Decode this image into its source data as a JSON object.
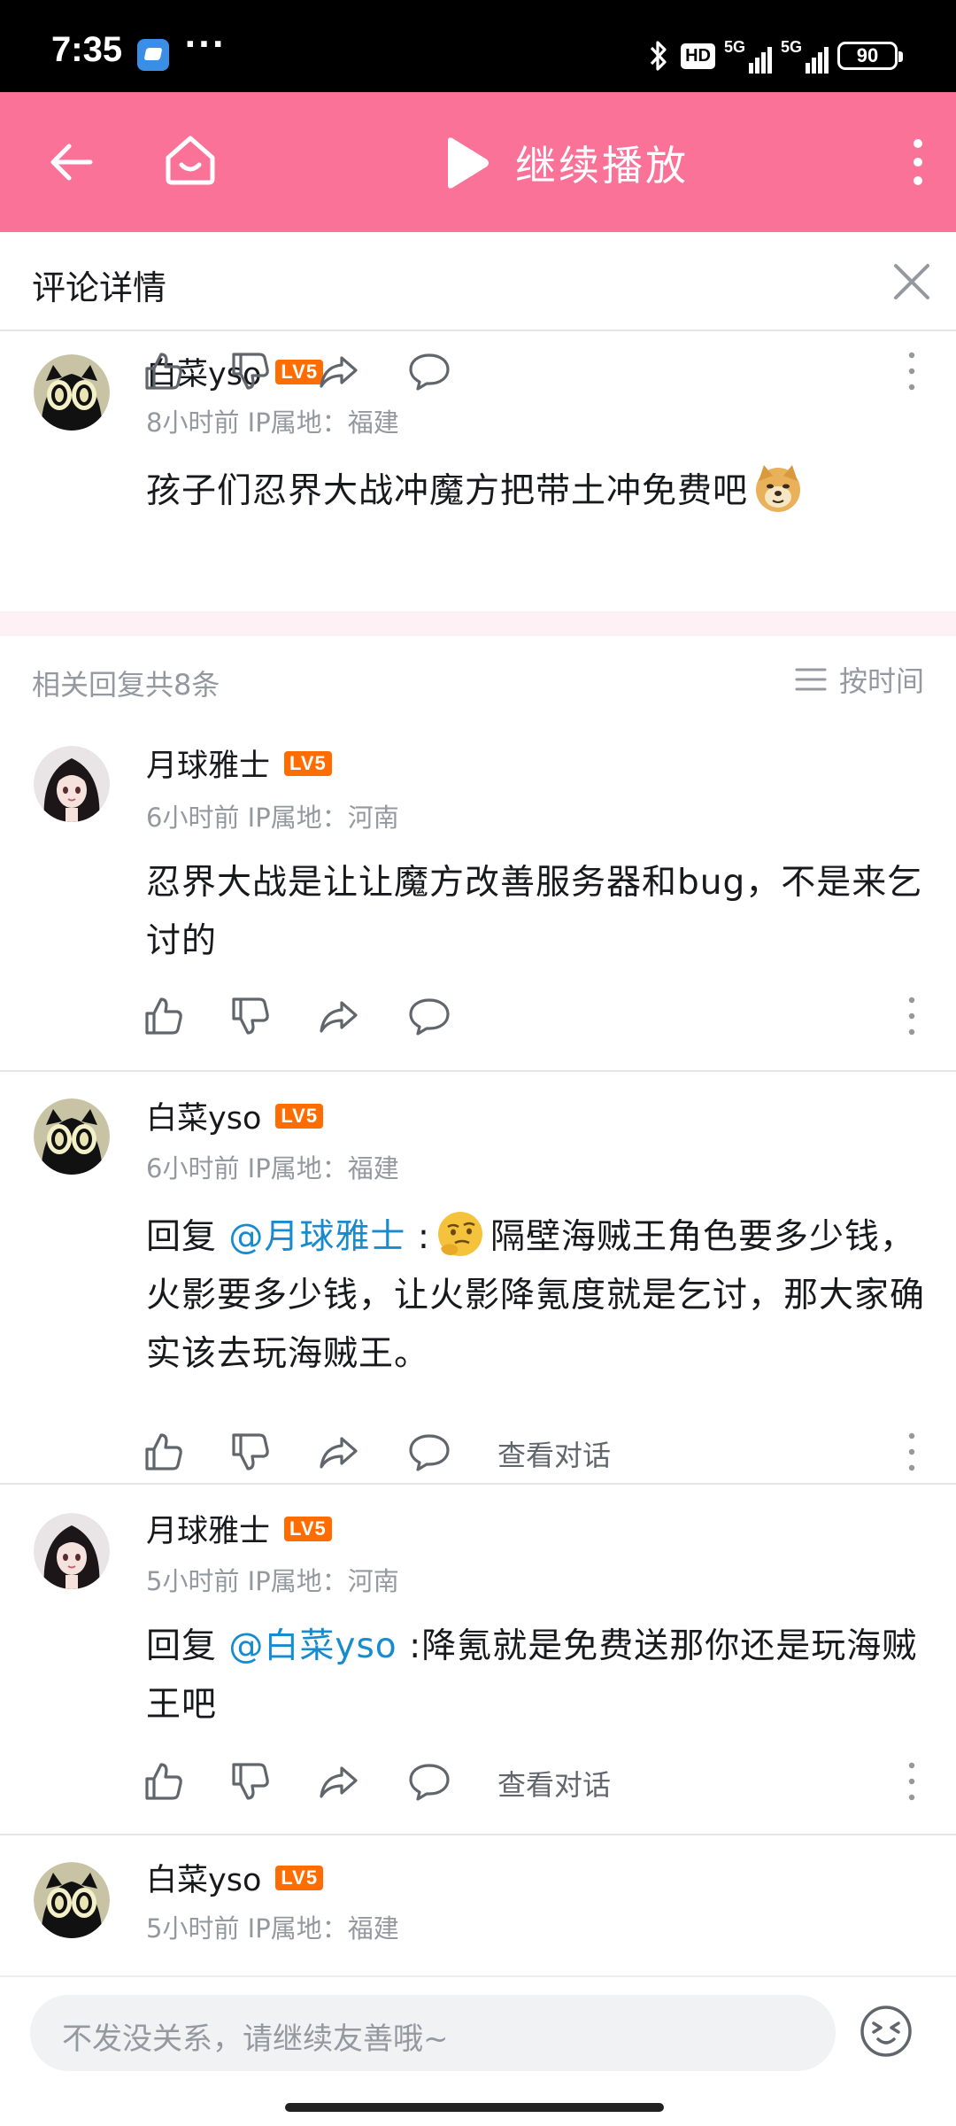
{
  "status_bar": {
    "time": "7:35",
    "dots": "···",
    "hd": "HD",
    "net1": "5G",
    "net2": "5G",
    "battery": "90"
  },
  "top_bar": {
    "back_icon": "back-arrow-icon",
    "home_icon": "home-icon",
    "play_label": "继续播放",
    "more_icon": "more-vertical-icon",
    "background": "#fb7299"
  },
  "detail": {
    "title": "评论详情",
    "close_icon": "close-icon"
  },
  "main_comment": {
    "user": "白菜yso",
    "level": "LV5",
    "meta": "8小时前 IP属地：福建",
    "text": "孩子们忍界大战冲魔方把带土冲免费吧",
    "emoji": "doge-emoji"
  },
  "replies_header": {
    "count": "相关回复共8条",
    "sort": "按时间"
  },
  "replies": [
    {
      "user": "月球雅士",
      "level": "LV5",
      "meta": "6小时前 IP属地：河南",
      "text": "忍界大战是让让魔方改善服务器和bug，不是来乞讨的"
    },
    {
      "user": "白菜yso",
      "level": "LV5",
      "meta": "6小时前 IP属地：福建",
      "reply_prefix": "回复 ",
      "mention": "@月球雅士",
      "colon": " :",
      "emoji": "thinking-emoji",
      "text": "隔壁海贼王角色要多少钱，火影要多少钱，让火影降氪度就是乞讨，那大家确实该去玩海贼王。",
      "chat_link": "查看对话"
    },
    {
      "user": "月球雅士",
      "level": "LV5",
      "meta": "5小时前 IP属地：河南",
      "reply_prefix": "回复 ",
      "mention": "@白菜yso",
      "text": " :降氪就是免费送那你还是玩海贼王吧",
      "chat_link": "查看对话"
    },
    {
      "user": "白菜yso",
      "level": "LV5",
      "meta": "5小时前 IP属地：福建"
    }
  ],
  "input": {
    "placeholder": "不发没关系，请继续友善哦~",
    "emoji_icon": "emoji-face-icon"
  },
  "colors": {
    "accent": "#fb7299",
    "mention": "#178bcf",
    "level_badge": "#ff6c00",
    "meta_text": "#9499a0"
  }
}
